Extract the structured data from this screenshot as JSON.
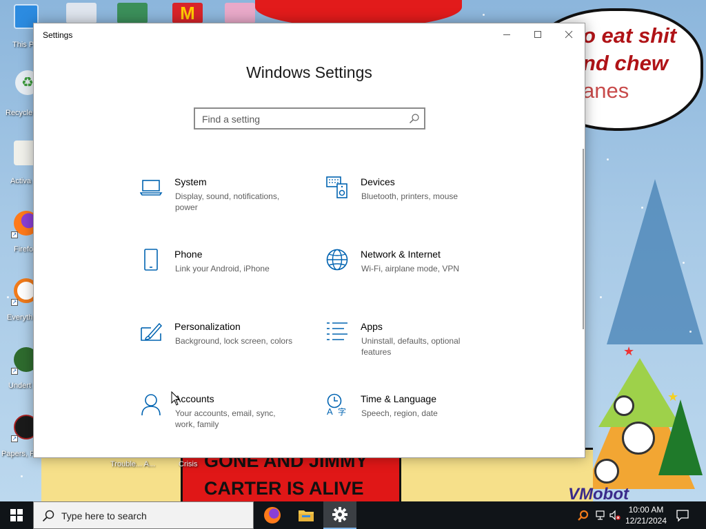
{
  "window": {
    "title": "Settings",
    "page_title": "Windows Settings",
    "search_placeholder": "Find a setting",
    "controls": [
      "minimize-icon",
      "maximize-icon",
      "close-icon"
    ]
  },
  "categories": [
    {
      "title": "System",
      "description": "Display, sound, notifications, power",
      "icon": "laptop-icon"
    },
    {
      "title": "Devices",
      "description": "Bluetooth, printers, mouse",
      "icon": "devices-icon"
    },
    {
      "title": "Phone",
      "description": "Link your Android, iPhone",
      "icon": "phone-icon"
    },
    {
      "title": "Network & Internet",
      "description": "Wi-Fi, airplane mode, VPN",
      "icon": "globe-icon"
    },
    {
      "title": "Personalization",
      "description": "Background, lock screen, colors",
      "icon": "paintbrush-icon"
    },
    {
      "title": "Apps",
      "description": "Uninstall, defaults, optional features",
      "icon": "apps-list-icon"
    },
    {
      "title": "Accounts",
      "description": "Your accounts, email, sync, work, family",
      "icon": "person-icon"
    },
    {
      "title": "Time & Language",
      "description": "Speech, region, date",
      "icon": "time-language-icon"
    }
  ],
  "desktop": {
    "icons": [
      {
        "label": "This P",
        "icon": "this-pc-icon"
      },
      {
        "label": "Recycle",
        "icon": "recycle-bin-icon"
      },
      {
        "label": "Activa",
        "icon": "activate-icon"
      },
      {
        "label": "Firefo",
        "icon": "firefox-icon"
      },
      {
        "label": "Everyth",
        "icon": "everything-search-icon"
      },
      {
        "label": "Undert",
        "icon": "undertale-icon"
      },
      {
        "label": "Papers, P",
        "icon": "papers-please-icon"
      }
    ],
    "bottom_labels": [
      "Trouble... A...",
      "Crisis"
    ],
    "wallpaper_text": {
      "bubble": [
        "o eat shit",
        "nd chew",
        "anes"
      ],
      "sign": [
        "GONE AND JIMMY",
        "CARTER IS ALIVE"
      ],
      "watermark": "VMobot"
    }
  },
  "taskbar": {
    "search_placeholder": "Type here to search",
    "pinned": [
      "firefox-icon",
      "file-explorer-icon",
      "settings-gear-icon"
    ],
    "active": "settings-gear-icon",
    "tray": [
      "everything-search-icon",
      "network-icon",
      "volume-muted-icon"
    ],
    "time": "10:00 AM",
    "date": "12/21/2024"
  },
  "colors": {
    "accent_icon": "#0063b1",
    "taskbar": "#101418",
    "window_bg": "#ffffff"
  }
}
